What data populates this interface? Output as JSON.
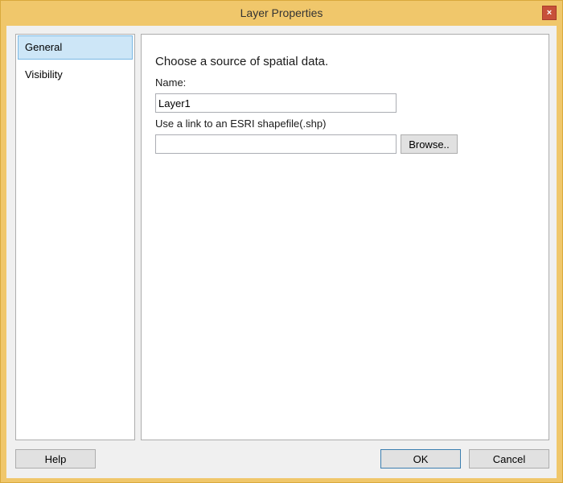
{
  "window": {
    "title": "Layer Properties",
    "close_glyph": "×"
  },
  "sidebar": {
    "items": [
      {
        "label": "General",
        "selected": true
      },
      {
        "label": "Visibility",
        "selected": false
      }
    ]
  },
  "general": {
    "heading": "Choose a source of spatial data.",
    "name_label": "Name:",
    "name_value": "Layer1",
    "shapefile_label": "Use a link to an ESRI shapefile(.shp)",
    "shapefile_value": "",
    "browse_label": "Browse.."
  },
  "footer": {
    "help_label": "Help",
    "ok_label": "OK",
    "cancel_label": "Cancel"
  },
  "colors": {
    "window_frame": "#f0c76b",
    "close_button": "#c7503a",
    "selected_item": "#cde6f7",
    "selected_border": "#7ab8e4"
  }
}
